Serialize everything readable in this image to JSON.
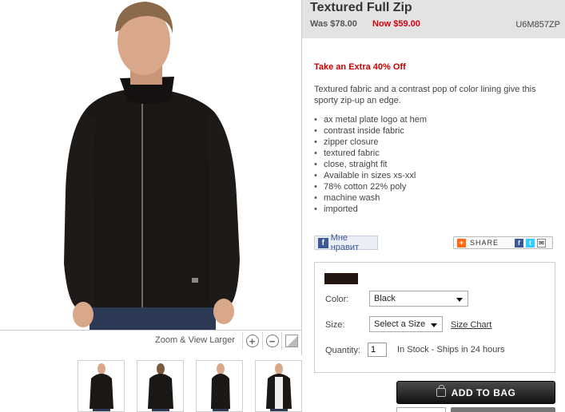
{
  "product": {
    "title": "Textured Full Zip",
    "was_price": "Was $78.00",
    "now_price": "Now $59.00",
    "sku": "U6M857ZP",
    "promo": "Take an Extra 40% Off",
    "description": "Textured fabric and a contrast pop of color lining give this sporty zip-up an edge.",
    "features": [
      "ax metal plate logo at hem",
      "contrast inside fabric",
      "zipper closure",
      "textured fabric",
      "close, straight fit",
      "Available in sizes xs-xxl",
      "78% cotton 22% poly",
      "machine wash",
      "imported"
    ]
  },
  "gallery": {
    "zoom_label": "Zoom & View Larger",
    "zoom_in_symbol": "+",
    "zoom_out_symbol": "−",
    "thumbnail_count": 4
  },
  "social": {
    "like_label": "Мне нравит",
    "share_label": "SHARE",
    "fb_glyph": "f",
    "tw_glyph": "t",
    "email_glyph": "✉",
    "plus_glyph": "+"
  },
  "options": {
    "color_label": "Color:",
    "color_value": "Black",
    "swatch_color": "#23150f",
    "size_label": "Size:",
    "size_value": "Select a Size",
    "size_chart_label": "Size Chart",
    "quantity_label": "Quantity:",
    "quantity_value": "1",
    "stock_text": "In Stock - Ships in 24 hours"
  },
  "actions": {
    "add_to_bag_label": "ADD TO BAG"
  },
  "colors": {
    "sale_red": "#d4000e",
    "header_bg": "#e3e3e3",
    "button_dark": "#111111"
  }
}
